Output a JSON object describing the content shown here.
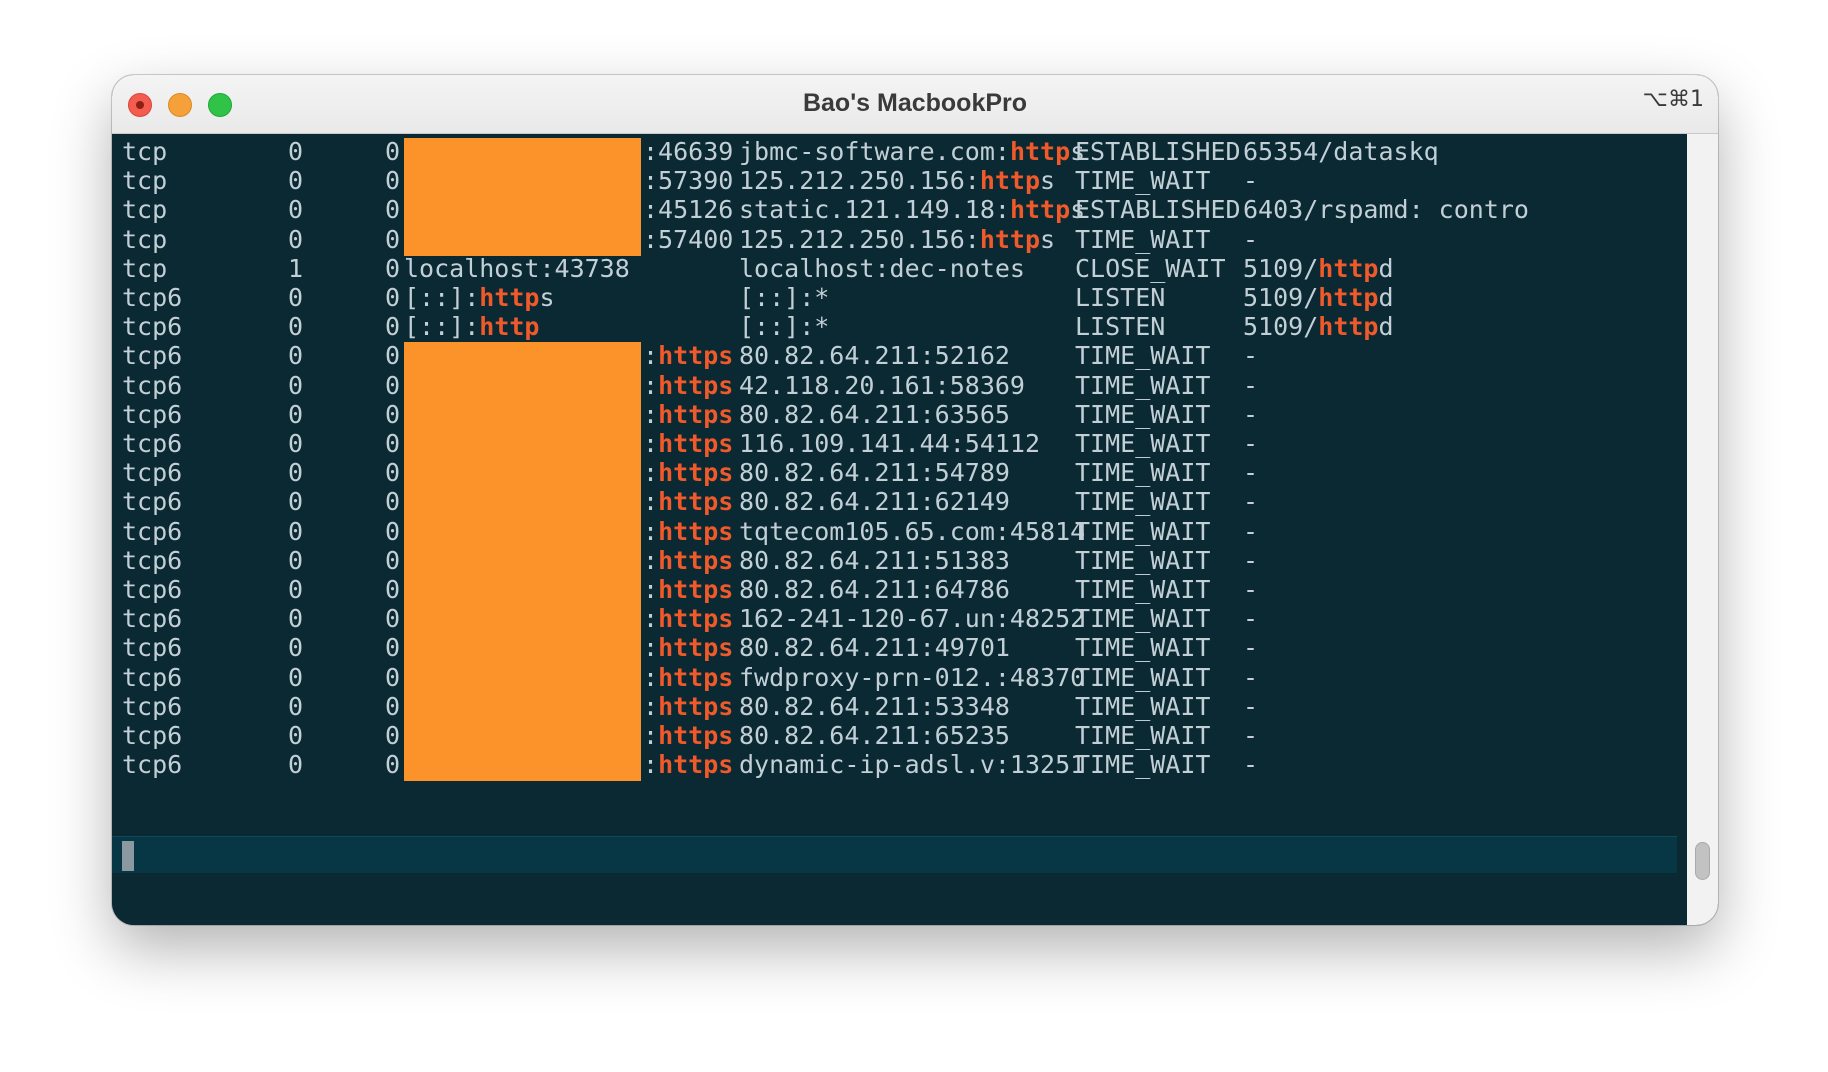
{
  "window": {
    "title": "Bao's MacbookPro",
    "shortcut": "⌥⌘1"
  },
  "colors": {
    "terminal_bg": "#0a2932",
    "text": "#c3cfd6",
    "highlight": "#f0592a",
    "redaction": "#fb922a"
  },
  "redactions": [
    {
      "from_row": 0,
      "to_row": 3
    },
    {
      "from_row": 7,
      "to_row": 21
    }
  ],
  "rows": [
    {
      "proto": "tcp",
      "recvq": "0",
      "sendq": "0",
      "local": "",
      "suffix": ":46639",
      "suffix_hl": "",
      "foreign": "jbmc-software.com:",
      "foreign_hl": "http",
      "foreign_tail": "s",
      "state": "ESTABLISHED",
      "prog": "65354/dataskq",
      "prog_hl": "",
      "prog_tail": ""
    },
    {
      "proto": "tcp",
      "recvq": "0",
      "sendq": "0",
      "local": "",
      "suffix": ":57390",
      "suffix_hl": "",
      "foreign": "125.212.250.156:",
      "foreign_hl": "http",
      "foreign_tail": "s",
      "state": "TIME_WAIT",
      "prog": "-",
      "prog_hl": "",
      "prog_tail": ""
    },
    {
      "proto": "tcp",
      "recvq": "0",
      "sendq": "0",
      "local": "",
      "suffix": ":45126",
      "suffix_hl": "",
      "foreign": "static.121.149.18:",
      "foreign_hl": "http",
      "foreign_tail": "s",
      "state": "ESTABLISHED",
      "prog": "6403/rspamd: contro",
      "prog_hl": "",
      "prog_tail": ""
    },
    {
      "proto": "tcp",
      "recvq": "0",
      "sendq": "0",
      "local": "",
      "suffix": ":57400",
      "suffix_hl": "",
      "foreign": "125.212.250.156:",
      "foreign_hl": "http",
      "foreign_tail": "s",
      "state": "TIME_WAIT",
      "prog": "-",
      "prog_hl": "",
      "prog_tail": ""
    },
    {
      "proto": "tcp",
      "recvq": "1",
      "sendq": "0",
      "local": "localhost:43738",
      "local_hl": "",
      "local_tail": "",
      "suffix": "",
      "suffix_hl": "",
      "foreign": "localhost:dec-notes",
      "foreign_hl": "",
      "foreign_tail": "",
      "state": "CLOSE_WAIT",
      "prog": "5109/",
      "prog_hl": "http",
      "prog_tail": "d"
    },
    {
      "proto": "tcp6",
      "recvq": "0",
      "sendq": "0",
      "local": "[::]:",
      "local_hl": "http",
      "local_tail": "s",
      "suffix": "",
      "suffix_hl": "",
      "foreign": "[::]:*",
      "foreign_hl": "",
      "foreign_tail": "",
      "state": "LISTEN",
      "prog": "5109/",
      "prog_hl": "http",
      "prog_tail": "d"
    },
    {
      "proto": "tcp6",
      "recvq": "0",
      "sendq": "0",
      "local": "[::]:",
      "local_hl": "http",
      "local_tail": "",
      "suffix": "",
      "suffix_hl": "",
      "foreign": "[::]:*",
      "foreign_hl": "",
      "foreign_tail": "",
      "state": "LISTEN",
      "prog": "5109/",
      "prog_hl": "http",
      "prog_tail": "d"
    },
    {
      "proto": "tcp6",
      "recvq": "0",
      "sendq": "0",
      "local": "",
      "suffix": ":",
      "suffix_hl": "https",
      "foreign": "80.82.64.211:52162",
      "foreign_hl": "",
      "foreign_tail": "",
      "state": "TIME_WAIT",
      "prog": "-",
      "prog_hl": "",
      "prog_tail": ""
    },
    {
      "proto": "tcp6",
      "recvq": "0",
      "sendq": "0",
      "local": "",
      "suffix": ":",
      "suffix_hl": "https",
      "foreign": "42.118.20.161:58369",
      "foreign_hl": "",
      "foreign_tail": "",
      "state": "TIME_WAIT",
      "prog": "-",
      "prog_hl": "",
      "prog_tail": ""
    },
    {
      "proto": "tcp6",
      "recvq": "0",
      "sendq": "0",
      "local": "",
      "suffix": ":",
      "suffix_hl": "https",
      "foreign": "80.82.64.211:63565",
      "foreign_hl": "",
      "foreign_tail": "",
      "state": "TIME_WAIT",
      "prog": "-",
      "prog_hl": "",
      "prog_tail": ""
    },
    {
      "proto": "tcp6",
      "recvq": "0",
      "sendq": "0",
      "local": "",
      "suffix": ":",
      "suffix_hl": "https",
      "foreign": "116.109.141.44:54112",
      "foreign_hl": "",
      "foreign_tail": "",
      "state": "TIME_WAIT",
      "prog": "-",
      "prog_hl": "",
      "prog_tail": ""
    },
    {
      "proto": "tcp6",
      "recvq": "0",
      "sendq": "0",
      "local": "",
      "suffix": ":",
      "suffix_hl": "https",
      "foreign": "80.82.64.211:54789",
      "foreign_hl": "",
      "foreign_tail": "",
      "state": "TIME_WAIT",
      "prog": "-",
      "prog_hl": "",
      "prog_tail": ""
    },
    {
      "proto": "tcp6",
      "recvq": "0",
      "sendq": "0",
      "local": "",
      "suffix": ":",
      "suffix_hl": "https",
      "foreign": "80.82.64.211:62149",
      "foreign_hl": "",
      "foreign_tail": "",
      "state": "TIME_WAIT",
      "prog": "-",
      "prog_hl": "",
      "prog_tail": ""
    },
    {
      "proto": "tcp6",
      "recvq": "0",
      "sendq": "0",
      "local": "",
      "suffix": ":",
      "suffix_hl": "https",
      "foreign": "tqtecom105.65.com:45814",
      "foreign_hl": "",
      "foreign_tail": "",
      "state": "TIME_WAIT",
      "prog": "-",
      "prog_hl": "",
      "prog_tail": ""
    },
    {
      "proto": "tcp6",
      "recvq": "0",
      "sendq": "0",
      "local": "",
      "suffix": ":",
      "suffix_hl": "https",
      "foreign": "80.82.64.211:51383",
      "foreign_hl": "",
      "foreign_tail": "",
      "state": "TIME_WAIT",
      "prog": "-",
      "prog_hl": "",
      "prog_tail": ""
    },
    {
      "proto": "tcp6",
      "recvq": "0",
      "sendq": "0",
      "local": "",
      "suffix": ":",
      "suffix_hl": "https",
      "foreign": "80.82.64.211:64786",
      "foreign_hl": "",
      "foreign_tail": "",
      "state": "TIME_WAIT",
      "prog": "-",
      "prog_hl": "",
      "prog_tail": ""
    },
    {
      "proto": "tcp6",
      "recvq": "0",
      "sendq": "0",
      "local": "",
      "suffix": ":",
      "suffix_hl": "https",
      "foreign": "162-241-120-67.un:48252",
      "foreign_hl": "",
      "foreign_tail": "",
      "state": "TIME_WAIT",
      "prog": "-",
      "prog_hl": "",
      "prog_tail": ""
    },
    {
      "proto": "tcp6",
      "recvq": "0",
      "sendq": "0",
      "local": "",
      "suffix": ":",
      "suffix_hl": "https",
      "foreign": "80.82.64.211:49701",
      "foreign_hl": "",
      "foreign_tail": "",
      "state": "TIME_WAIT",
      "prog": "-",
      "prog_hl": "",
      "prog_tail": ""
    },
    {
      "proto": "tcp6",
      "recvq": "0",
      "sendq": "0",
      "local": "",
      "suffix": ":",
      "suffix_hl": "https",
      "foreign": "fwdproxy-prn-012.:48370",
      "foreign_hl": "",
      "foreign_tail": "",
      "state": "TIME_WAIT",
      "prog": "-",
      "prog_hl": "",
      "prog_tail": ""
    },
    {
      "proto": "tcp6",
      "recvq": "0",
      "sendq": "0",
      "local": "",
      "suffix": ":",
      "suffix_hl": "https",
      "foreign": "80.82.64.211:53348",
      "foreign_hl": "",
      "foreign_tail": "",
      "state": "TIME_WAIT",
      "prog": "-",
      "prog_hl": "",
      "prog_tail": ""
    },
    {
      "proto": "tcp6",
      "recvq": "0",
      "sendq": "0",
      "local": "",
      "suffix": ":",
      "suffix_hl": "https",
      "foreign": "80.82.64.211:65235",
      "foreign_hl": "",
      "foreign_tail": "",
      "state": "TIME_WAIT",
      "prog": "-",
      "prog_hl": "",
      "prog_tail": ""
    },
    {
      "proto": "tcp6",
      "recvq": "0",
      "sendq": "0",
      "local": "",
      "suffix": ":",
      "suffix_hl": "https",
      "foreign": "dynamic-ip-adsl.v:13251",
      "foreign_hl": "",
      "foreign_tail": "",
      "state": "TIME_WAIT",
      "prog": "-",
      "prog_hl": "",
      "prog_tail": ""
    }
  ]
}
